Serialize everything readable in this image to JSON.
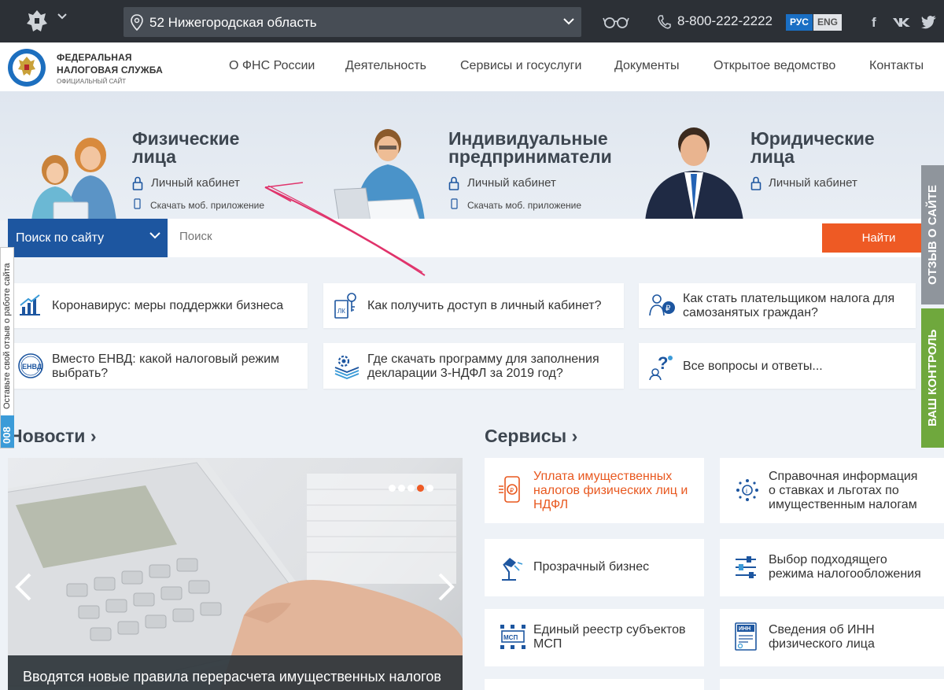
{
  "topbar": {
    "region": "52 Нижегородская область",
    "phone": "8-800-222-2222",
    "lang_ru": "РУС",
    "lang_en": "ENG",
    "social": [
      "f",
      "vk",
      "twitter"
    ]
  },
  "header": {
    "brand_line1": "ФЕДЕРАЛЬНАЯ",
    "brand_line2": "НАЛОГОВАЯ СЛУЖБА",
    "brand_line3": "ОФИЦИАЛЬНЫЙ САЙТ",
    "nav": [
      "О ФНС России",
      "Деятельность",
      "Сервисы и госуслуги",
      "Документы",
      "Открытое ведомство",
      "Контакты"
    ]
  },
  "hero": {
    "categories": [
      {
        "title1": "Физические",
        "title2": "лица",
        "cabinet": "Личный кабинет",
        "app": "Скачать моб. приложение"
      },
      {
        "title1": "Индивидуальные",
        "title2": "предприниматели",
        "cabinet": "Личный кабинет",
        "app": "Скачать моб. приложение"
      },
      {
        "title1": "Юридические",
        "title2": "лица",
        "cabinet": "Личный кабинет",
        "app": ""
      }
    ]
  },
  "search": {
    "scope": "Поиск по сайту",
    "placeholder": "Поиск",
    "button": "Найти"
  },
  "quick_links": [
    {
      "label1": "Коронавирус: меры поддержки бизнеса",
      "label2": "",
      "icon": "chart-growth-icon"
    },
    {
      "label1": "Как получить доступ в личный кабинет?",
      "label2": "",
      "icon": "key-cabinet-icon"
    },
    {
      "label1": "Как стать плательщиком налога для",
      "label2": "самозанятых граждан?",
      "icon": "self-employed-icon"
    },
    {
      "label1": "Вместо ЕНВД: какой налоговый режим",
      "label2": "выбрать?",
      "icon": "envd-badge-icon"
    },
    {
      "label1": "Где скачать программу для заполнения",
      "label2": "декларации 3-НДФЛ за 2019 год?",
      "icon": "download-program-icon"
    },
    {
      "label1": "Все вопросы и ответы...",
      "label2": "",
      "icon": "questions-icon"
    }
  ],
  "envd_badge": "ЕНВД",
  "news": {
    "title": "Новости",
    "caption": "Вводятся новые правила перерасчета имущественных налогов",
    "slides": 5,
    "active_slide": 4
  },
  "services": {
    "title": "Сервисы",
    "items": [
      {
        "l1": "Уплата имущественных",
        "l2": "налогов физических лиц и",
        "l3": "НДФЛ",
        "icon": "payment-phone-icon"
      },
      {
        "l1": "Справочная информация",
        "l2": "о ставках и льготах по",
        "l3": "имущественным налогам",
        "icon": "reference-info-icon"
      },
      {
        "l1": "Прозрачный бизнес",
        "l2": "",
        "l3": "",
        "icon": "lamp-icon"
      },
      {
        "l1": "Выбор подходящего",
        "l2": "режима налогообложения",
        "l3": "",
        "icon": "sliders-icon"
      },
      {
        "l1": "Единый реестр субъектов",
        "l2": "МСП",
        "l3": "",
        "icon": "msp-registry-icon"
      },
      {
        "l1": "Сведения об ИНН",
        "l2": "физического лица",
        "l3": "",
        "icon": "inn-document-icon"
      }
    ],
    "msp_badge": "МСП",
    "inn_badge": "ИНН"
  },
  "side_tabs": {
    "feedback": "ОТЗЫВ О САЙТЕ",
    "control": "ВАШ КОНТРОЛЬ",
    "left_text": "Оставьте свой отзыв о работе сайта",
    "left_count": "008"
  },
  "colors": {
    "accent_orange": "#ee5a24",
    "brand_blue": "#1d56a0",
    "dark_bar": "#2c3036",
    "green_tab": "#6fa83d"
  }
}
